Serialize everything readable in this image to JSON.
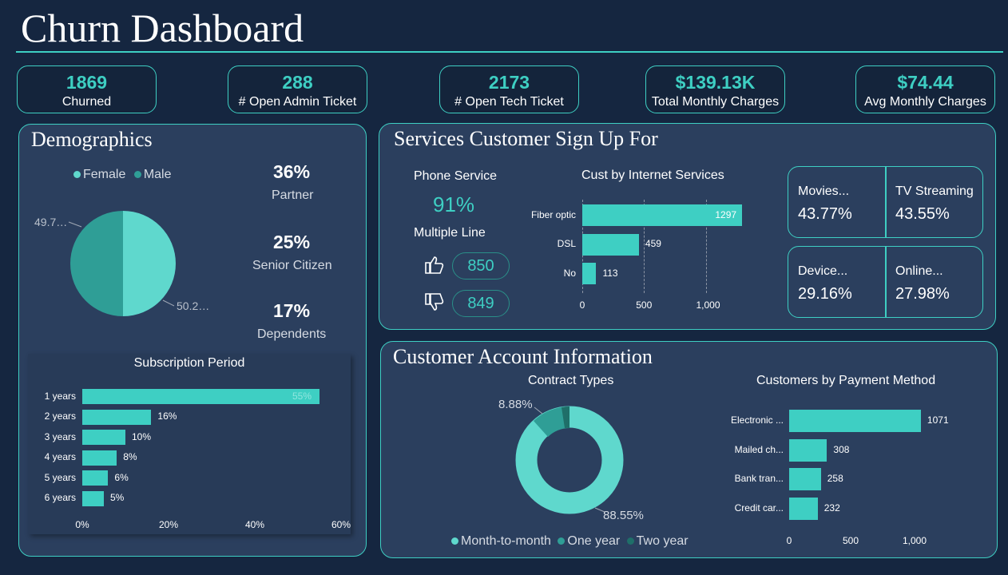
{
  "title": "Churn Dashboard",
  "kpis": [
    {
      "value": "1869",
      "label": "Churned"
    },
    {
      "value": "288",
      "label": "# Open Admin Ticket"
    },
    {
      "value": "2173",
      "label": "# Open Tech Ticket"
    },
    {
      "value": "$139.13K",
      "label": "Total Monthly Charges"
    },
    {
      "value": "$74.44",
      "label": "Avg Monthly Charges"
    }
  ],
  "demographics": {
    "title": "Demographics",
    "legend": [
      "Female",
      "Male"
    ],
    "pie": {
      "female_label": "50.2…",
      "male_label": "49.7…",
      "female_pct": 50.2,
      "male_pct": 49.7
    },
    "stats": [
      {
        "value": "36%",
        "label": "Partner"
      },
      {
        "value": "25%",
        "label": "Senior Citizen"
      },
      {
        "value": "17%",
        "label": "Dependents"
      }
    ],
    "subscription": {
      "title": "Subscription Period",
      "rows": [
        {
          "label": "1 years",
          "value": 55,
          "text": "55%"
        },
        {
          "label": "2 years",
          "value": 16,
          "text": "16%"
        },
        {
          "label": "3 years",
          "value": 10,
          "text": "10%"
        },
        {
          "label": "4 years",
          "value": 8,
          "text": "8%"
        },
        {
          "label": "5 years",
          "value": 6,
          "text": "6%"
        },
        {
          "label": "6 years",
          "value": 5,
          "text": "5%"
        }
      ],
      "ticks": [
        "0%",
        "20%",
        "40%",
        "60%"
      ]
    }
  },
  "services": {
    "title": "Services Customer Sign Up For",
    "phone_label": "Phone Service",
    "phone_value": "91%",
    "multiple_label": "Multiple Line",
    "multiple_yes": "850",
    "multiple_no": "849",
    "internet": {
      "title": "Cust by Internet Services",
      "rows": [
        {
          "label": "Fiber optic",
          "value": 1297,
          "text": "1297"
        },
        {
          "label": "DSL",
          "value": 459,
          "text": "459"
        },
        {
          "label": "No",
          "value": 113,
          "text": "113"
        }
      ],
      "ticks": [
        "0",
        "500",
        "1,000"
      ]
    },
    "cards": [
      {
        "title": "Movies...",
        "value": "43.77%"
      },
      {
        "title": "TV Streaming",
        "value": "43.55%"
      },
      {
        "title": "Device...",
        "value": "29.16%"
      },
      {
        "title": "Online...",
        "value": "27.98%"
      }
    ]
  },
  "account": {
    "title": "Customer Account Information",
    "contract": {
      "title": "Contract Types",
      "label_one": "8.88%",
      "label_month": "88.55%",
      "legend": [
        "Month-to-month",
        "One year",
        "Two year"
      ]
    },
    "payment": {
      "title": "Customers by Payment Method",
      "rows": [
        {
          "label": "Electronic ...",
          "value": 1071,
          "text": "1071"
        },
        {
          "label": "Mailed ch...",
          "value": 308,
          "text": "308"
        },
        {
          "label": "Bank tran...",
          "value": 258,
          "text": "258"
        },
        {
          "label": "Credit car...",
          "value": 232,
          "text": "232"
        }
      ],
      "ticks": [
        "0",
        "500",
        "1,000"
      ]
    }
  },
  "colors": {
    "accent": "#3ecfc3",
    "dark_teal": "#2f9e96",
    "deeper_teal": "#1f6f69",
    "panel": "#2b3f5e",
    "background": "#152640"
  }
}
